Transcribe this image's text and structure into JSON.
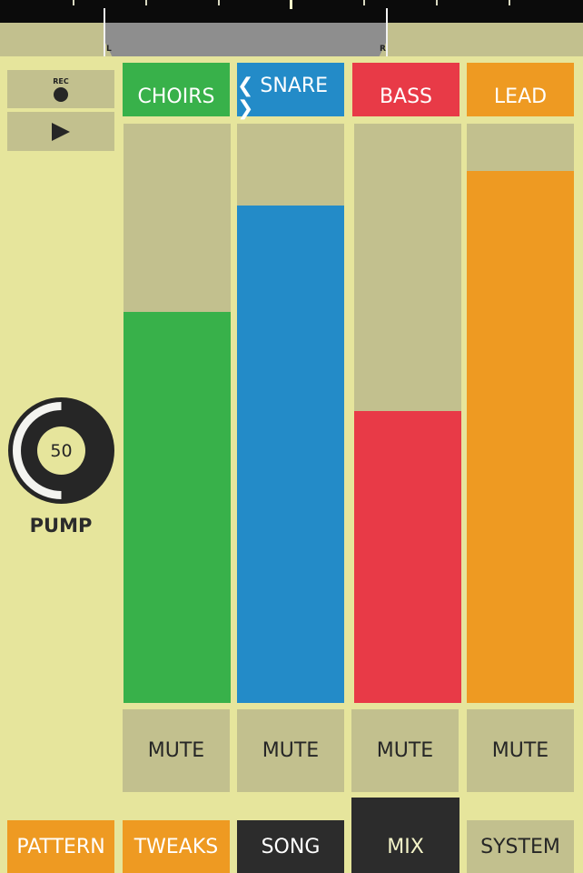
{
  "transport": {
    "rec_label": "REC",
    "rec_icon": "record-dot-icon",
    "play_icon": "play-triangle-icon"
  },
  "pan": {
    "left_label": "L",
    "right_label": "R"
  },
  "knob": {
    "value": "50",
    "level": 0.5,
    "label": "PUMP"
  },
  "channels": [
    {
      "name": "CHOIRS",
      "color": "#38b14a",
      "level": 0.675,
      "mute_label": "MUTE"
    },
    {
      "name": "❮ SNARE ❯",
      "color": "#238bc8",
      "level": 0.858,
      "mute_label": "MUTE"
    },
    {
      "name": "BASS",
      "color": "#e83a47",
      "level": 0.504,
      "mute_label": "MUTE"
    },
    {
      "name": "LEAD",
      "color": "#ee9a22",
      "level": 0.918,
      "mute_label": "MUTE"
    }
  ],
  "nav": [
    {
      "label": "PATTERN",
      "bg": "#ee9a22",
      "fg": "#ffffff"
    },
    {
      "label": "TWEAKS",
      "bg": "#ee9a22",
      "fg": "#ffffff"
    },
    {
      "label": "SONG",
      "bg": "#2c2c2c",
      "fg": "#ffffff"
    },
    {
      "label": "MIX",
      "bg": "#2c2c2c",
      "fg": "#f4f4c8",
      "active": true
    },
    {
      "label": "SYSTEM",
      "bg": "#c2c08e",
      "fg": "#262626"
    }
  ],
  "colors": {
    "background": "#e6e59c",
    "panel": "#c2c08e",
    "dark": "#262626"
  }
}
